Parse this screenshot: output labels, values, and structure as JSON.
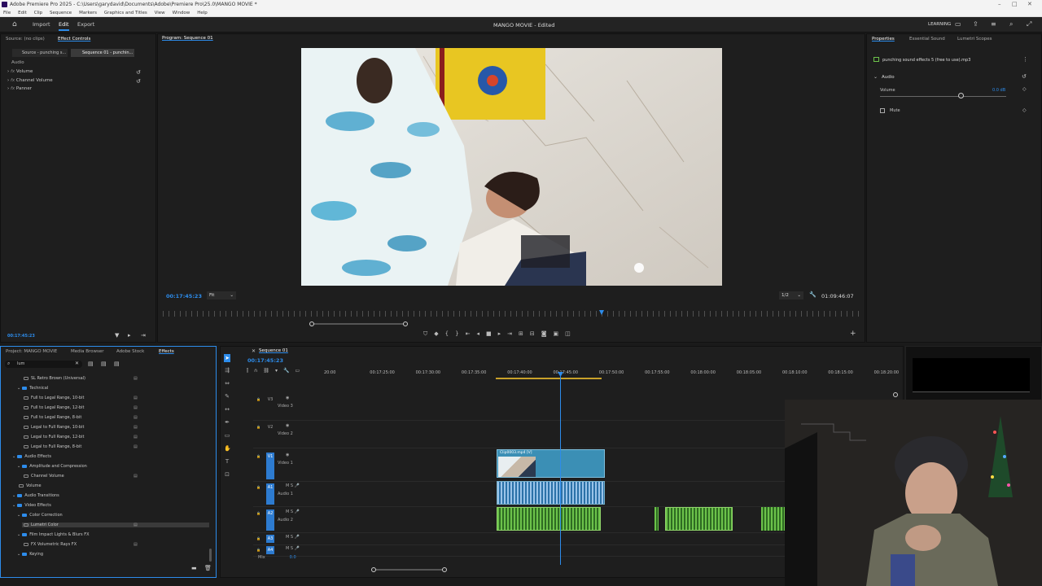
{
  "titlebar": {
    "title": "Adobe Premiere Pro 2025 - C:\\Users\\garydavid\\Documents\\Adobe\\Premiere Pro\\25.0\\MANGO MOVIE *"
  },
  "menu": [
    "File",
    "Edit",
    "Clip",
    "Sequence",
    "Markers",
    "Graphics and Titles",
    "View",
    "Window",
    "Help"
  ],
  "header": {
    "nav": [
      "Import",
      "Edit",
      "Export"
    ],
    "active": "Edit",
    "project_title": "MANGO MOVIE - Edited",
    "workspace_label": "LEARNING"
  },
  "source_panel": {
    "tabs": [
      "Source: (no clips)",
      "Effect Controls"
    ],
    "clip_tabs": [
      "Source - punching s...",
      "Sequence 01 - punchin..."
    ],
    "section": "Audio",
    "effects": [
      "Volume",
      "Channel Volume",
      "Panner"
    ],
    "timecode": "00:17:45:23"
  },
  "program": {
    "title": "Program: Sequence 01",
    "timecode": "00:17:45:23",
    "fit": "Fit",
    "resolution": "1/2",
    "duration": "01:09:46:07"
  },
  "properties": {
    "tabs": [
      "Properties",
      "Essential Sound",
      "Lumetri Scopes"
    ],
    "clip_name": "punching sound effects 5 (free to use).mp3",
    "section": "Audio",
    "volume_label": "Volume",
    "volume_value": "0.0 dB",
    "mute_label": "Mute"
  },
  "project_panel": {
    "tabs": [
      "Project: MANGO MOVIE",
      "Media Browser",
      "Adobe Stock",
      "Effects"
    ],
    "search": "lum",
    "items": [
      {
        "label": "SL Retro Brown (Universal)",
        "indent": 3,
        "folder": false
      },
      {
        "label": "Technical",
        "indent": 2,
        "folder": true
      },
      {
        "label": "Full to Legal Range, 10-bit",
        "indent": 3,
        "folder": false
      },
      {
        "label": "Full to Legal Range, 12-bit",
        "indent": 3,
        "folder": false
      },
      {
        "label": "Full to Legal Range, 8-bit",
        "indent": 3,
        "folder": false
      },
      {
        "label": "Legal to Full Range, 10-bit",
        "indent": 3,
        "folder": false
      },
      {
        "label": "Legal to Full Range, 12-bit",
        "indent": 3,
        "folder": false
      },
      {
        "label": "Legal to Full Range, 8-bit",
        "indent": 3,
        "folder": false
      },
      {
        "label": "Audio Effects",
        "indent": 1,
        "folder": true
      },
      {
        "label": "Amplitude and Compression",
        "indent": 2,
        "folder": true
      },
      {
        "label": "Channel Volume",
        "indent": 3,
        "folder": false
      },
      {
        "label": "Volume",
        "indent": 2,
        "folder": false
      },
      {
        "label": "Audio Transitions",
        "indent": 1,
        "folder": true
      },
      {
        "label": "Video Effects",
        "indent": 1,
        "folder": true
      },
      {
        "label": "Color Correction",
        "indent": 2,
        "folder": true
      },
      {
        "label": "Lumetri Color",
        "indent": 3,
        "folder": false
      },
      {
        "label": "Film Impact Lights & Blurs FX",
        "indent": 2,
        "folder": true
      },
      {
        "label": "FX Volumetric Rays FX",
        "indent": 3,
        "folder": false
      },
      {
        "label": "Keying",
        "indent": 2,
        "folder": true
      }
    ]
  },
  "timeline": {
    "title": "Sequence 01",
    "timecode": "00:17:45:23",
    "ruler": [
      "20:00",
      "00:17:25:00",
      "00:17:30:00",
      "00:17:35:00",
      "00:17:40:00",
      "00:17:45:00",
      "00:17:50:00",
      "00:17:55:00",
      "00:18:00:00",
      "00:18:05:00",
      "00:18:10:00",
      "00:18:15:00",
      "00:18:20:00"
    ],
    "tracks": [
      {
        "id": "V3",
        "name": "Video 3"
      },
      {
        "id": "V2",
        "name": "Video 2"
      },
      {
        "id": "V1",
        "name": "Video 1"
      },
      {
        "id": "A1",
        "name": "Audio 1"
      },
      {
        "id": "A2",
        "name": "Audio 2"
      },
      {
        "id": "A3",
        "name": ""
      },
      {
        "id": "A4",
        "name": ""
      }
    ],
    "mix_label": "Mix",
    "mix_value": "0.0",
    "video_clip": "Clip0003.mp4 [V]"
  },
  "colors": {
    "accent": "#2d8ceb",
    "audio_clip": "#5aa43a",
    "video_clip": "#3b8fb5"
  }
}
